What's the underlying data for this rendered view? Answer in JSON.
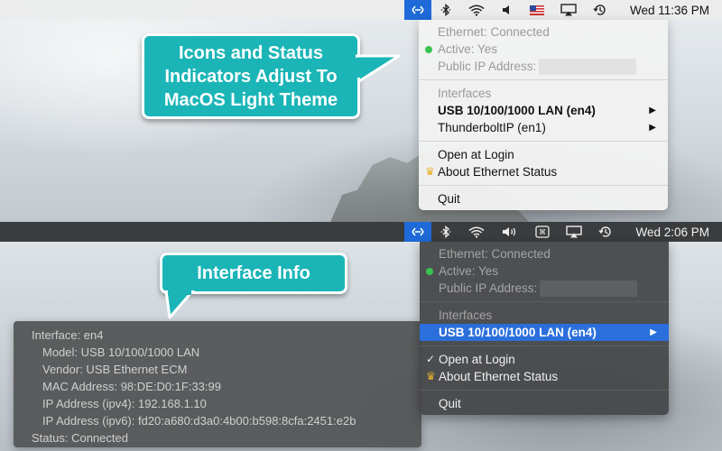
{
  "top": {
    "menubar": {
      "icons": [
        "ethernet-status-icon",
        "bluetooth-icon",
        "wifi-icon",
        "volume-icon",
        "us-flag-icon",
        "airplay-icon",
        "time-machine-icon"
      ],
      "clock": "Wed 11:36 PM"
    },
    "callout": {
      "line1": "Icons and Status",
      "line2": "Indicators Adjust To",
      "line3": "MacOS Light Theme"
    },
    "menu": {
      "status": "Ethernet: Connected",
      "active": "Active: Yes",
      "public_ip_label": "Public IP Address:",
      "interfaces_header": "Interfaces",
      "iface1": "USB 10/100/1000 LAN (en4)",
      "iface2": "ThunderboltIP (en1)",
      "open_login": "Open at Login",
      "about": "About Ethernet Status",
      "quit": "Quit",
      "submenu_arrow": "▶",
      "about_icon": "crown-icon"
    }
  },
  "bottom": {
    "menubar": {
      "icons": [
        "ethernet-status-icon",
        "bluetooth-icon",
        "wifi-icon",
        "volume-icon",
        "keyboard-input-icon",
        "airplay-icon",
        "time-machine-icon"
      ],
      "clock": "Wed 2:06 PM"
    },
    "callout": {
      "label": "Interface Info"
    },
    "menu": {
      "status": "Ethernet: Connected",
      "active": "Active: Yes",
      "public_ip_label": "Public IP Address:",
      "interfaces_header": "Interfaces",
      "iface1": "USB 10/100/1000 LAN (en4)",
      "open_login": "Open at Login",
      "about": "About Ethernet Status",
      "quit": "Quit",
      "checkmark": "✓",
      "submenu_arrow": "▶"
    },
    "info": {
      "interface": "Interface: en4",
      "model": "Model: USB 10/100/1000 LAN",
      "vendor": "Vendor: USB Ethernet ECM",
      "mac": "MAC Address: 98:DE:D0:1F:33:99",
      "ipv4": "IP Address (ipv4): 192.168.1.10",
      "ipv6": "IP Address (ipv6): fd20:a680:d3a0:4b00:b598:8cfa:2451:e2b",
      "status": "Status: Connected"
    }
  },
  "colors": {
    "callout_teal": "#1bb5b7",
    "highlight_blue": "#2a6fdb",
    "active_green": "#39c34f",
    "crown_gold": "#e7b12a"
  }
}
